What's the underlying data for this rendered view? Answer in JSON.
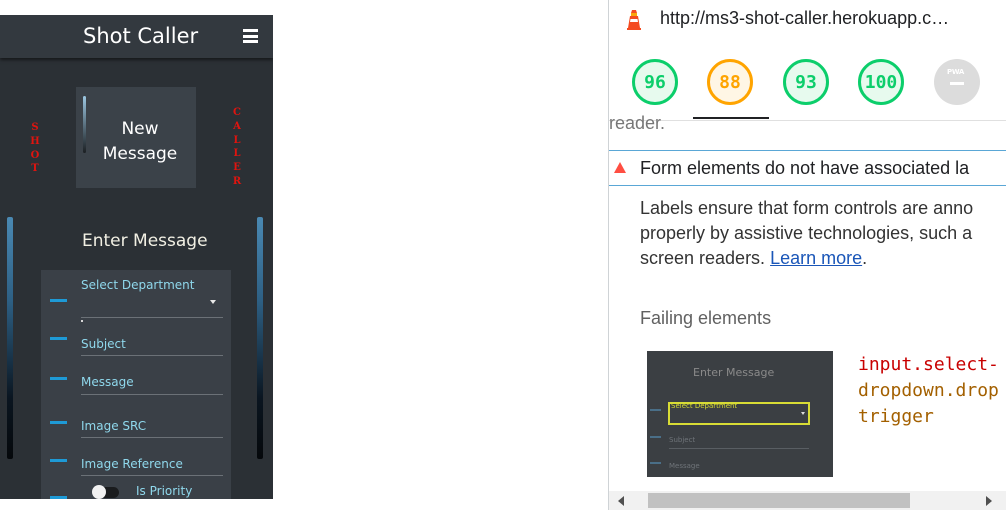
{
  "app": {
    "title": "Shot Caller",
    "side_left": "SHOT",
    "side_right": "CALLER",
    "new_message_button": "New Message",
    "form_title": "Enter Message",
    "fields": [
      {
        "label": "Select Department"
      },
      {
        "label": "Subject"
      },
      {
        "label": "Message"
      },
      {
        "label": "Image SRC"
      },
      {
        "label": "Image Reference"
      }
    ],
    "priority_toggle_label": "Is Priority"
  },
  "devtools": {
    "url": "http://ms3-shot-caller.herokuapp.c…",
    "scores": [
      {
        "value": "96",
        "status": "pass",
        "color": "#0cce6b"
      },
      {
        "value": "88",
        "status": "average",
        "color": "#ffa400"
      },
      {
        "value": "93",
        "status": "pass",
        "color": "#0cce6b"
      },
      {
        "value": "100",
        "status": "pass",
        "color": "#0cce6b"
      },
      {
        "value": "—",
        "status": "na",
        "badge": "PWA",
        "color": "#dcdcdc"
      }
    ],
    "reader_fragment": "reader.",
    "audit_title": "Form elements do not have associated la",
    "audit_desc_1": "Labels ensure that form controls are anno",
    "audit_desc_2": "properly by assistive technologies, such a",
    "audit_desc_3": "screen readers.",
    "learn_more": "Learn more",
    "audit_desc_end": ".",
    "failing_heading": "Failing elements",
    "thumbnail": {
      "title": "Enter Message",
      "field_label": "Select Department",
      "subject": "Subject",
      "message": "Message"
    },
    "selector_1": "input.select-",
    "selector_2": "dropdown.drop",
    "selector_3": "trigger"
  }
}
